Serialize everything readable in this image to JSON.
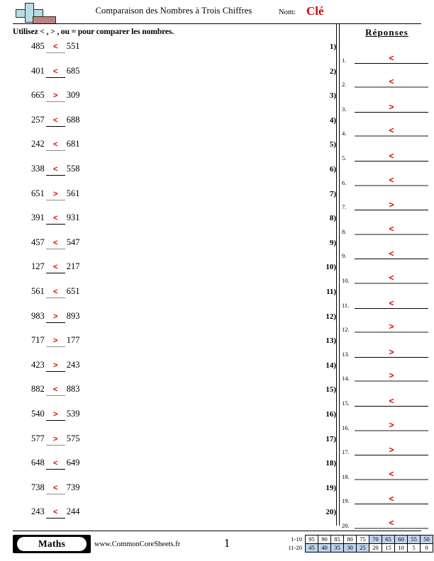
{
  "header": {
    "title": "Comparaison des Nombres à Trois Chiffres",
    "name_label": "Nom:",
    "name_value": "Clé",
    "logo_icon": "plus-block-logo"
  },
  "instructions": "Utilisez < , > , ou = pour comparer les nombres.",
  "problems": [
    {
      "num": "1)",
      "left": "485",
      "symbol": "<",
      "right": "551"
    },
    {
      "num": "2)",
      "left": "401",
      "symbol": "<",
      "right": "685"
    },
    {
      "num": "3)",
      "left": "665",
      "symbol": ">",
      "right": "309"
    },
    {
      "num": "4)",
      "left": "257",
      "symbol": "<",
      "right": "688"
    },
    {
      "num": "5)",
      "left": "242",
      "symbol": "<",
      "right": "681"
    },
    {
      "num": "6)",
      "left": "338",
      "symbol": "<",
      "right": "558"
    },
    {
      "num": "7)",
      "left": "651",
      "symbol": ">",
      "right": "561"
    },
    {
      "num": "8)",
      "left": "391",
      "symbol": "<",
      "right": "931"
    },
    {
      "num": "9)",
      "left": "457",
      "symbol": "<",
      "right": "547"
    },
    {
      "num": "10)",
      "left": "127",
      "symbol": "<",
      "right": "217"
    },
    {
      "num": "11)",
      "left": "561",
      "symbol": "<",
      "right": "651"
    },
    {
      "num": "12)",
      "left": "983",
      "symbol": ">",
      "right": "893"
    },
    {
      "num": "13)",
      "left": "717",
      "symbol": ">",
      "right": "177"
    },
    {
      "num": "14)",
      "left": "423",
      "symbol": ">",
      "right": "243"
    },
    {
      "num": "15)",
      "left": "882",
      "symbol": "<",
      "right": "883"
    },
    {
      "num": "16)",
      "left": "540",
      "symbol": ">",
      "right": "539"
    },
    {
      "num": "17)",
      "left": "577",
      "symbol": ">",
      "right": "575"
    },
    {
      "num": "18)",
      "left": "648",
      "symbol": "<",
      "right": "649"
    },
    {
      "num": "19)",
      "left": "738",
      "symbol": "<",
      "right": "739"
    },
    {
      "num": "20)",
      "left": "243",
      "symbol": "<",
      "right": "244"
    }
  ],
  "answers": {
    "title": "Réponses",
    "items": [
      {
        "num": "1.",
        "symbol": "<"
      },
      {
        "num": "2.",
        "symbol": "<"
      },
      {
        "num": "3.",
        "symbol": ">"
      },
      {
        "num": "4.",
        "symbol": "<"
      },
      {
        "num": "5.",
        "symbol": "<"
      },
      {
        "num": "6.",
        "symbol": "<"
      },
      {
        "num": "7.",
        "symbol": ">"
      },
      {
        "num": "8.",
        "symbol": "<"
      },
      {
        "num": "9.",
        "symbol": "<"
      },
      {
        "num": "10.",
        "symbol": "<"
      },
      {
        "num": "11.",
        "symbol": "<"
      },
      {
        "num": "12.",
        "symbol": ">"
      },
      {
        "num": "13.",
        "symbol": ">"
      },
      {
        "num": "14.",
        "symbol": ">"
      },
      {
        "num": "15.",
        "symbol": "<"
      },
      {
        "num": "16.",
        "symbol": ">"
      },
      {
        "num": "17.",
        "symbol": ">"
      },
      {
        "num": "18.",
        "symbol": "<"
      },
      {
        "num": "19.",
        "symbol": "<"
      },
      {
        "num": "20.",
        "symbol": "<"
      }
    ]
  },
  "footer": {
    "brand": "Maths",
    "site": "www.CommonCoreSheets.fr",
    "page_number": "1"
  },
  "score_table": {
    "rows": [
      {
        "label": "1-10",
        "cells": [
          {
            "value": "95",
            "highlight": false
          },
          {
            "value": "90",
            "highlight": false
          },
          {
            "value": "85",
            "highlight": false
          },
          {
            "value": "80",
            "highlight": false
          },
          {
            "value": "75",
            "highlight": false
          },
          {
            "value": "70",
            "highlight": true
          },
          {
            "value": "65",
            "highlight": true
          },
          {
            "value": "60",
            "highlight": true
          },
          {
            "value": "55",
            "highlight": true
          },
          {
            "value": "50",
            "highlight": true
          }
        ]
      },
      {
        "label": "11-20",
        "cells": [
          {
            "value": "45",
            "highlight": true
          },
          {
            "value": "40",
            "highlight": true
          },
          {
            "value": "35",
            "highlight": true
          },
          {
            "value": "30",
            "highlight": true
          },
          {
            "value": "25",
            "highlight": true
          },
          {
            "value": "20",
            "highlight": false
          },
          {
            "value": "15",
            "highlight": false
          },
          {
            "value": "10",
            "highlight": false
          },
          {
            "value": "5",
            "highlight": false
          },
          {
            "value": "0",
            "highlight": false
          }
        ]
      }
    ],
    "highlight_color": "#bcd2ee"
  }
}
